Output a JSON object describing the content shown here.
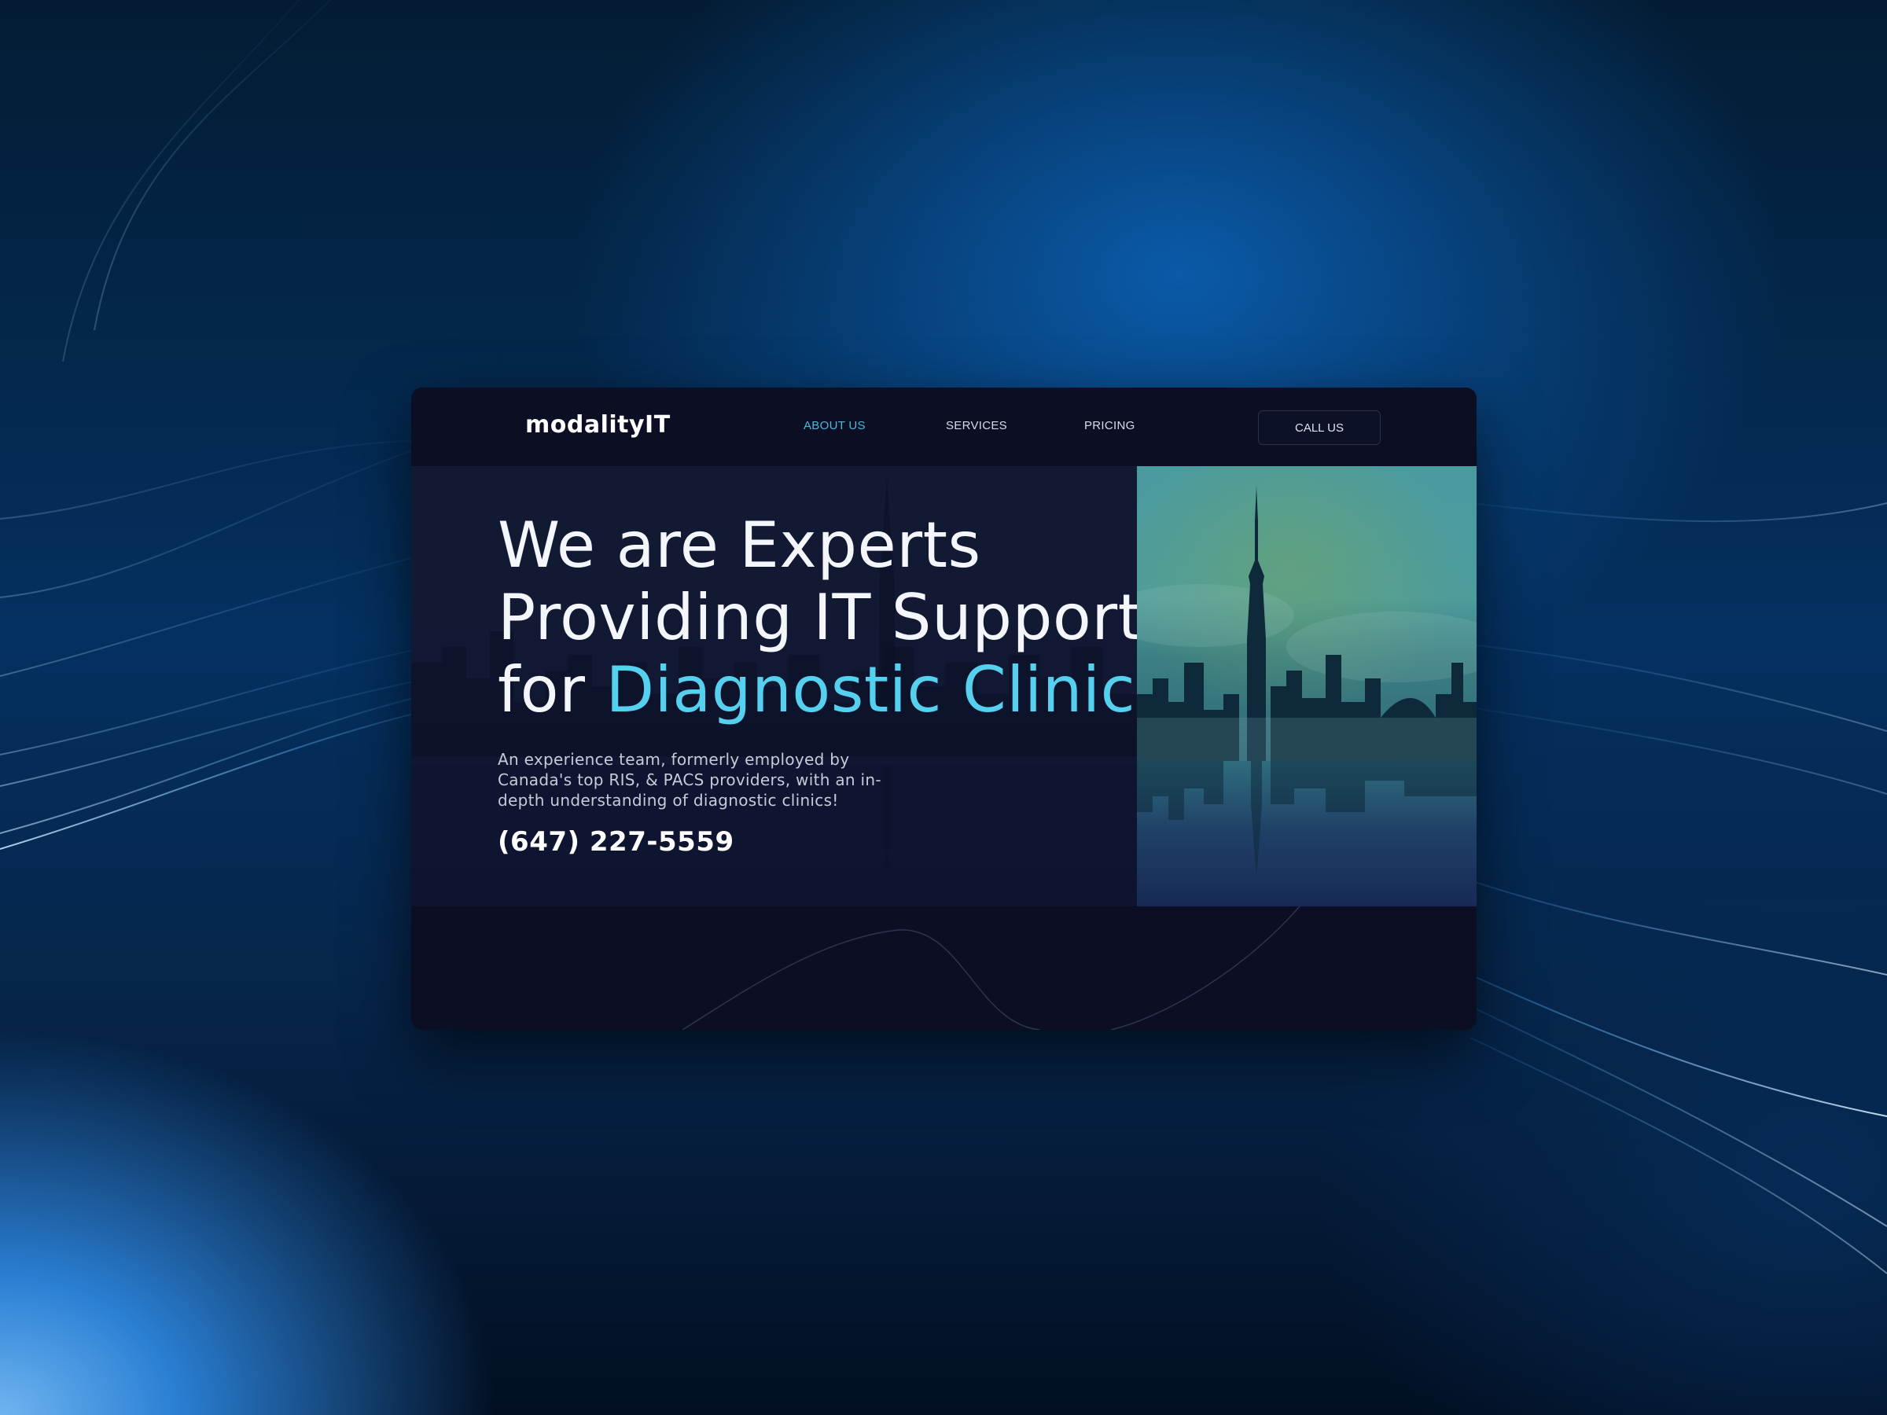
{
  "brand": {
    "logo": "modalityIT"
  },
  "nav": {
    "items": [
      {
        "label": "ABOUT US",
        "active": true
      },
      {
        "label": "SERVICES",
        "active": false
      },
      {
        "label": "PRICING",
        "active": false
      }
    ],
    "cta_label": "CALL US"
  },
  "hero": {
    "headline_line1": "We are Experts",
    "headline_line2": "Providing IT Support",
    "headline_line3_prefix": "for ",
    "headline_line3_accent": "Diagnostic Clinics!",
    "subtext": "An experience team, formerly employed by Canada's top RIS, & PACS providers, with an in-depth understanding of diagnostic clinics!",
    "phone": "(647) 227-5559"
  },
  "colors": {
    "accent": "#55d0ee",
    "nav_active": "#4fb6d8",
    "window_bg": "#0c0f24",
    "photo_teal": "#4a9aa0"
  }
}
